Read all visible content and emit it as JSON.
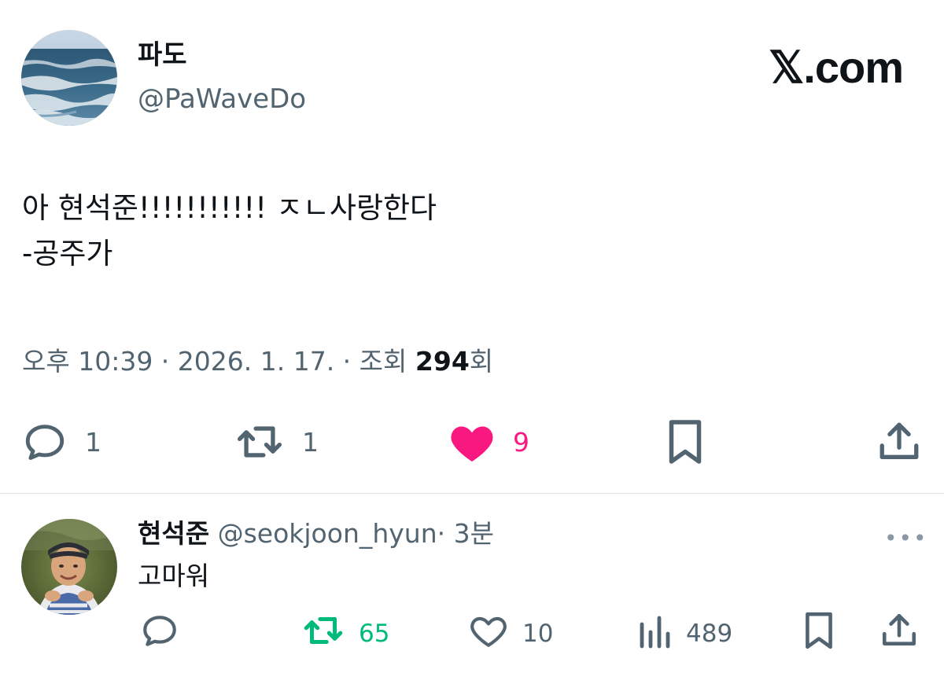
{
  "brand": {
    "label": "𝕏.com"
  },
  "tweet": {
    "display_name": "파도",
    "handle": "@PaWaveDo",
    "body_line1": "아 현석준!!!!!!!!!!! ㅈㄴ사랑한다",
    "body_line2": "-공주가",
    "meta_prefix": "오후 10:39 · 2026. 1. 17. · 조회 ",
    "views": "294",
    "meta_suffix": "회",
    "actions": {
      "reply_count": "1",
      "retweet_count": "1",
      "like_count": "9"
    }
  },
  "reply": {
    "display_name": "현석준",
    "handle": "@seokjoon_hyun",
    "time": "· 3분",
    "text": "고마워",
    "more": "•••",
    "actions": {
      "retweet_count": "65",
      "like_count": "10",
      "views_count": "489"
    }
  },
  "colors": {
    "like_active": "#f91880",
    "retweet_active": "#00ba7c",
    "secondary_text": "#536471"
  }
}
